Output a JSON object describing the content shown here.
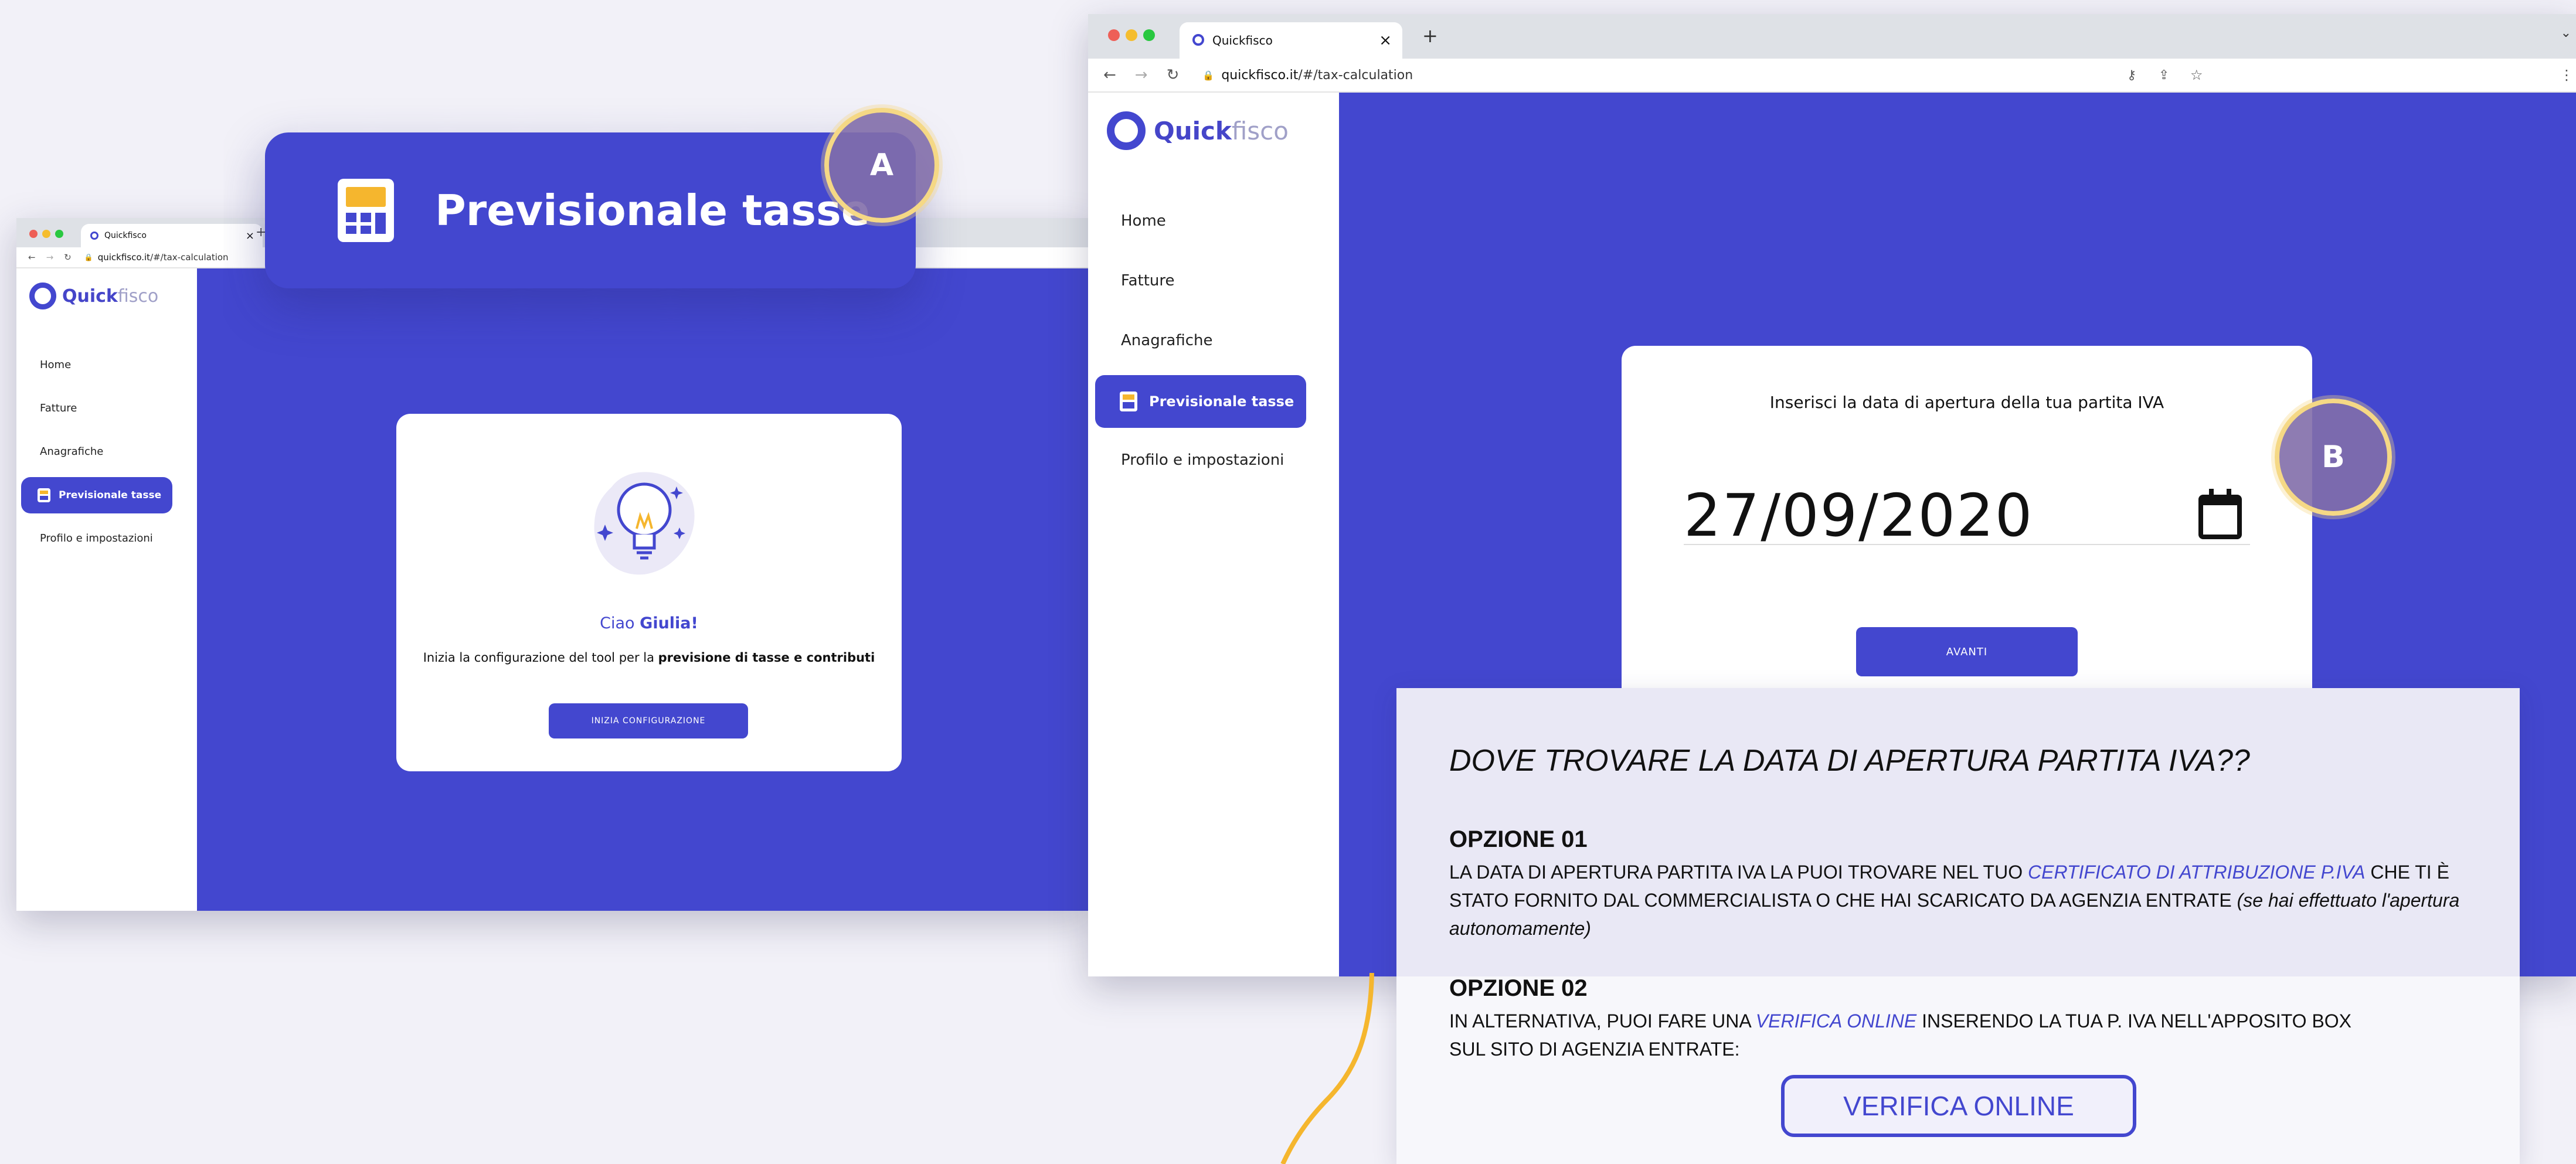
{
  "colors": {
    "brand": "#4347cf",
    "highlight": "#f5d885",
    "background": "#f2f1f8"
  },
  "browser": {
    "tab_title": "Quickfisco",
    "url_domain": "quickfisco.it",
    "url_path": "/#/tax-calculation",
    "new_tab_symbol": "+",
    "close_tab_symbol": "×"
  },
  "logo": {
    "part1": "Quick",
    "part2": "fisco"
  },
  "sidebar": {
    "items": [
      {
        "label": "Home"
      },
      {
        "label": "Fatture"
      },
      {
        "label": "Anagrafiche"
      },
      {
        "label": "Previsionale tasse"
      },
      {
        "label": "Profilo e impostazioni"
      }
    ]
  },
  "left_screen": {
    "greeting_prefix": "Ciao ",
    "greeting_name": "Giulia!",
    "intro_text": "Inizia la configurazione del tool per la ",
    "intro_bold": "previsione di tasse e contributi",
    "button_label": "INIZIA CONFIGURAZIONE"
  },
  "callout_a": {
    "label": "Previsionale tasse",
    "marker": "A"
  },
  "right_screen": {
    "prompt": "Inserisci la data di apertura della tua partita IVA",
    "date_value": "27/09/2020",
    "button_label": "AVANTI",
    "marker": "B"
  },
  "info_panel": {
    "title": "DOVE TROVARE LA DATA DI APERTURA PARTITA IVA??",
    "option1_title": "OPZIONE 01",
    "option1_text_a": "LA DATA DI APERTURA PARTITA IVA LA PUOI TROVARE NEL TUO ",
    "option1_link": "CERTIFICATO DI ATTRIBUZIONE P.IVA",
    "option1_text_b": " CHE TI È STATO FORNITO DAL COMMERCIALISTA O CHE HAI SCARICATO DA AGENZIA ENTRATE ",
    "option1_italic": "(se hai effettuato l'apertura autonomamente)",
    "option2_title": "OPZIONE 02",
    "option2_text_a": "IN ALTERNATIVA, PUOI FARE UNA ",
    "option2_link": "VERIFICA ONLINE",
    "option2_text_b": " INSERENDO LA TUA P. IVA NELL'APPOSITO BOX SUL SITO DI AGENZIA ENTRATE:",
    "verify_button": "VERIFICA ONLINE"
  }
}
